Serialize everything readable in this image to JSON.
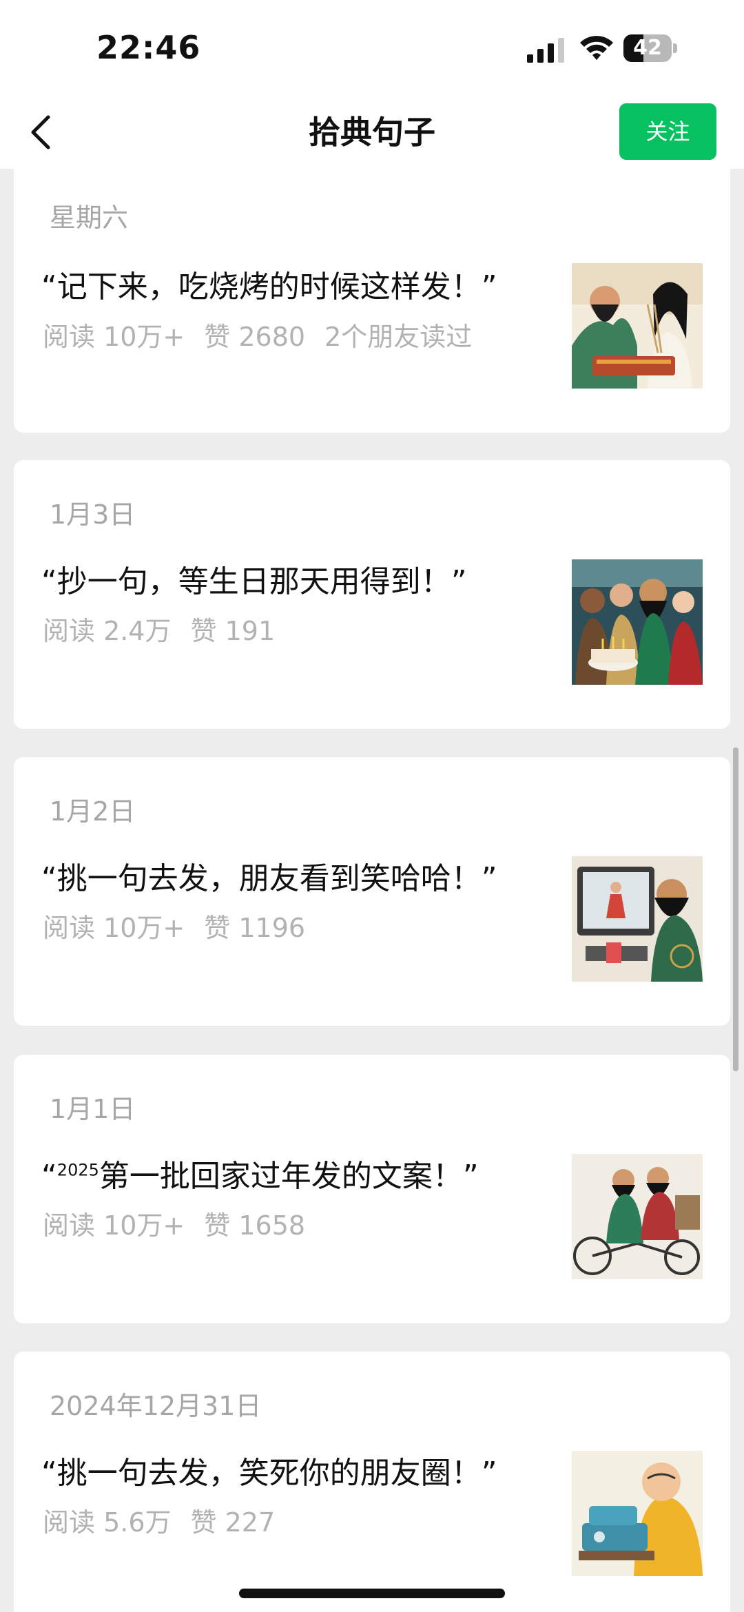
{
  "status_bar": {
    "time": "22:46",
    "battery": "42",
    "battery_level": 0.42,
    "icons": [
      "signal-icon",
      "wifi-icon",
      "battery-icon"
    ]
  },
  "nav": {
    "title": "拾典句子",
    "follow_label": "关注",
    "back_icon": "chevron-left-icon",
    "accent_color": "#07c160"
  },
  "articles": [
    {
      "title": "“记下来，吃烧烤的时候这样发！”",
      "reads": "阅读 10万+",
      "likes": "赞 2680",
      "friends": "2个朋友读过",
      "thumb": "bbq-illustration"
    },
    {
      "date": "1月3日",
      "title": "“抄一句，等生日那天用得到！”",
      "reads": "阅读 2.4万",
      "likes": "赞 191",
      "thumb": "birthday-illustration"
    },
    {
      "date": "1月2日",
      "title": "“挑一句去发，朋友看到笑哈哈！”",
      "reads": "阅读 10万+",
      "likes": "赞 1196",
      "thumb": "computer-illustration"
    },
    {
      "date": "1月1日",
      "title_prefix": "“",
      "title_sup": "2025",
      "title_rest": "第一批回家过年发的文案！”",
      "reads": "阅读 10万+",
      "likes": "赞 1658",
      "thumb": "tricycle-illustration"
    },
    {
      "date": "2024年12月31日",
      "title": "“挑一句去发，笑死你的朋友圈！”",
      "reads": "阅读 5.6万",
      "likes": "赞 227",
      "thumb": "sewing-illustration"
    }
  ],
  "first_card_date": "星期六"
}
